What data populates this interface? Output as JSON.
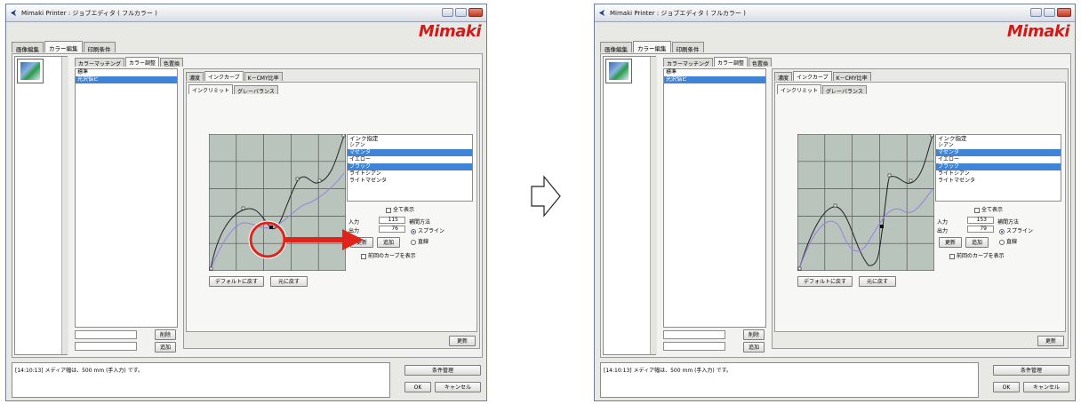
{
  "window": {
    "title": "Mimaki Printer : ジョブエディタ ( フルカラー )",
    "brand": "Mimaki"
  },
  "tabs": {
    "image_edit": "画像編集",
    "color_edit": "カラー編集",
    "print_conditions": "印刷条件"
  },
  "color_tabs": {
    "matching": "カラーマッチング",
    "adjust": "カラー調整",
    "replace": "色置換"
  },
  "adjust_list": {
    "items": [
      "標準",
      "光沢悩ビ"
    ],
    "selected": 1
  },
  "left_buttons": {
    "delete": "削除",
    "add": "追加"
  },
  "adjust_tabs": {
    "density": "濃度",
    "ink_curve": "インクカーブ",
    "k_cmy": "K－CMY比率"
  },
  "ink_tabs": {
    "limit": "インクリミット",
    "gray": "グレーバランス"
  },
  "ink_list": {
    "header": "インク指定",
    "items": [
      "シアン",
      "マゼンタ",
      "イエロー",
      "ブラック",
      "ライトシアン",
      "ライトマゼンタ"
    ],
    "selected": [
      1,
      3
    ]
  },
  "show_all": "全て表示",
  "input_label": "入力",
  "output_label": "出力",
  "interp_label": "補間方法",
  "spline": "スプライン",
  "linear": "直線",
  "update": "更新",
  "add": "追加",
  "prev_curve": "前回のカーブを表示",
  "default_btn": "デフォルトに戻す",
  "undo_btn": "元に戻す",
  "apply_btn": "更新",
  "status_message": "[14:10:13] メディア幅は、500 mm (手入力) です。",
  "manage": "条件管理",
  "ok": "OK",
  "cancel": "キャンセル",
  "before": {
    "input_value": "115",
    "output_value": "76"
  },
  "after": {
    "input_value": "153",
    "output_value": "79"
  },
  "colors": {
    "accent_red": "#e0231b",
    "select_blue": "#3f84d6",
    "curve_black": "#222222",
    "curve_purple": "#9a7fdc",
    "graph_bg": "#b9c4bd"
  }
}
